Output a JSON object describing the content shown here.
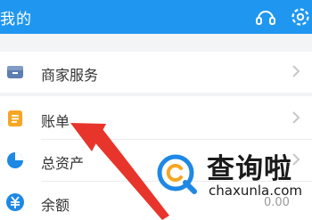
{
  "header": {
    "title": "我的",
    "icons": [
      "customer-service-icon",
      "settings-icon"
    ]
  },
  "menu": {
    "items": [
      {
        "label": "商家服务",
        "icon": "merchant-service-icon",
        "icon_color": "#5b7fb0"
      },
      {
        "label": "账单",
        "icon": "bill-icon",
        "icon_color": "#f5a623"
      },
      {
        "label": "总资产",
        "icon": "total-assets-icon",
        "icon_color": "#1e88e5"
      },
      {
        "label": "余额",
        "icon": "balance-icon",
        "icon_color": "#1e88e5"
      }
    ],
    "balance_amount": "0.00"
  },
  "watermark": {
    "title": "查询啦",
    "url": "chaxunla.com"
  },
  "colors": {
    "accent": "#1f97f0",
    "arrow": "#e8352c"
  }
}
